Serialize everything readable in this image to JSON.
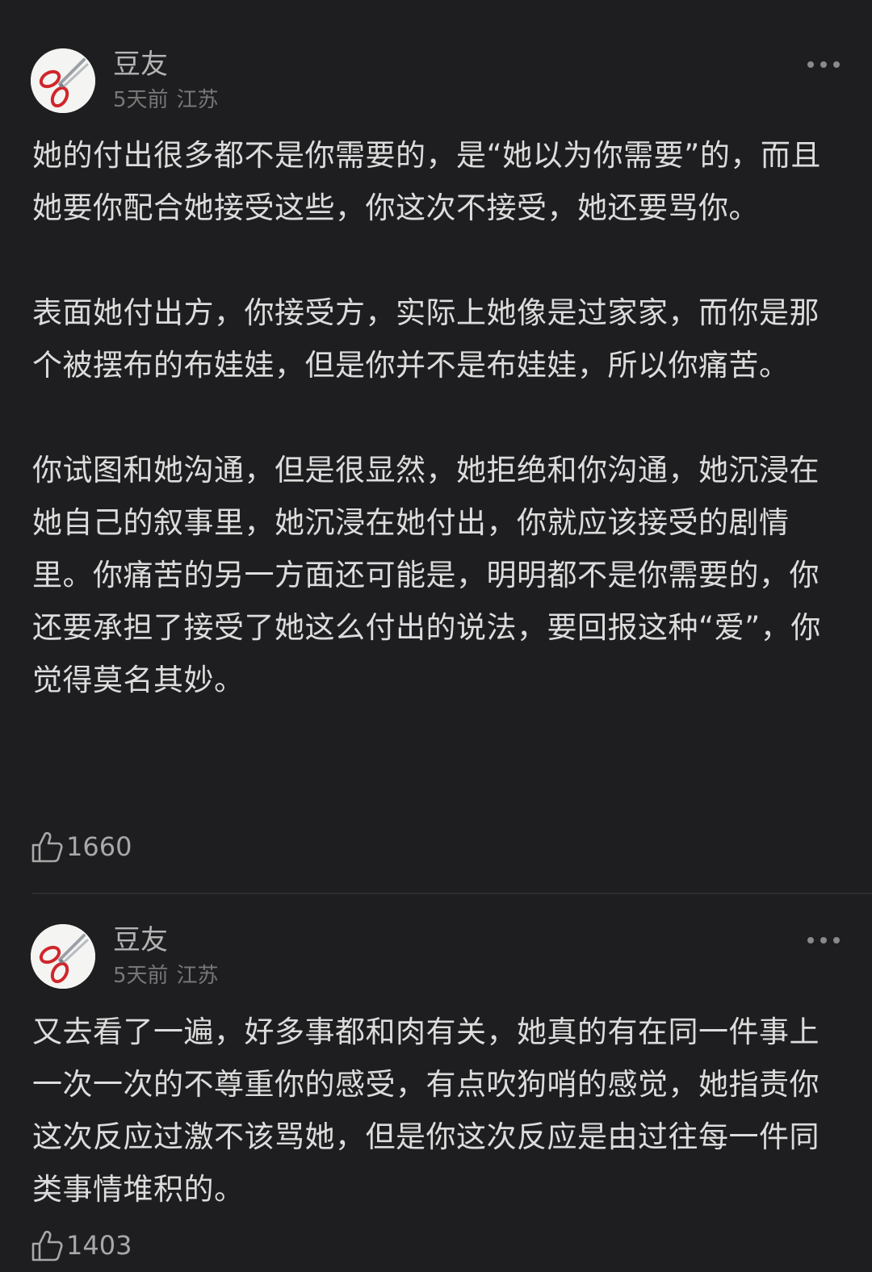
{
  "comments": [
    {
      "username": "豆友",
      "time": "5天前",
      "location": "江苏",
      "paragraphs": [
        "她的付出很多都不是你需要的，是“她以为你需要”的，而且她要你配合她接受这些，你这次不接受，她还要骂你。",
        "表面她付出方，你接受方，实际上她像是过家家，而你是那个被摆布的布娃娃，但是你并不是布娃娃，所以你痛苦。",
        "你试图和她沟通，但是很显然，她拒绝和你沟通，她沉浸在她自己的叙事里，她沉浸在她付出，你就应该接受的剧情里。你痛苦的另一方面还可能是，明明都不是你需要的，你还要承担了接受了她这么付出的说法，要回报这种“爱”，你觉得莫名其妙。"
      ],
      "likes": "1660"
    },
    {
      "username": "豆友",
      "time": "5天前",
      "location": "江苏",
      "paragraphs": [
        "又去看了一遍，好多事都和肉有关，她真的有在同一件事上一次一次的不尊重你的感受，有点吹狗哨的感觉，她指责你这次反应过激不该骂她，但是你这次反应是由过往每一件同类事情堆积的。"
      ],
      "likes": "1403"
    }
  ],
  "icons": {
    "avatar": "scissors-icon",
    "more": "more-dots-icon",
    "like": "thumbs-up-icon"
  }
}
